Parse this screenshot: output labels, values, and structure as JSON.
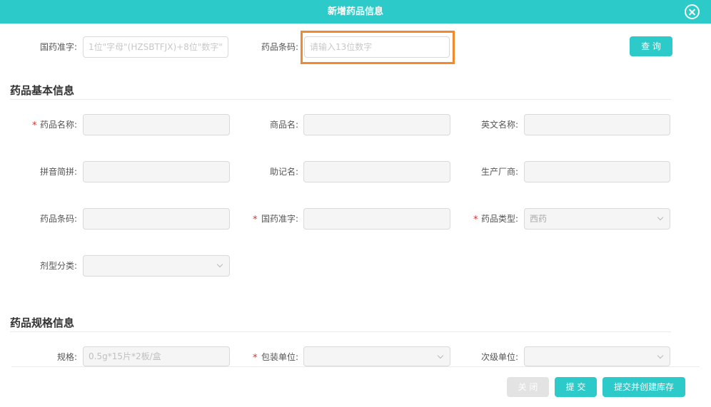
{
  "header": {
    "title": "新增药品信息"
  },
  "search": {
    "approval_label": "国药准字:",
    "approval_placeholder": "1位\"字母\"(HZSBTFJX)+8位\"数字\"",
    "barcode_label": "药品条码:",
    "barcode_placeholder": "请输入13位数字",
    "query_label": "查 询"
  },
  "basic": {
    "section_title": "药品基本信息",
    "required_mark": "*",
    "drug_name_label": "药品名称:",
    "trade_name_label": "商品名:",
    "english_name_label": "英文名称:",
    "pinyin_label": "拼音简拼:",
    "mnemonic_label": "助记名:",
    "manufacturer_label": "生产厂商:",
    "barcode_label": "药品条码:",
    "approval_label": "国药准字:",
    "drug_type_label": "药品类型:",
    "drug_type_value": "西药",
    "dosage_form_label": "剂型分类:"
  },
  "spec": {
    "section_title": "药品规格信息",
    "spec_label": "规格:",
    "spec_placeholder": "0.5g*15片*2板/盒",
    "pack_unit_label": "包装单位:",
    "sub_unit_label": "次级单位:"
  },
  "footer": {
    "close_label": "关 闭",
    "submit_label": "提 交",
    "submit_stock_label": "提交并创建库存"
  },
  "colors": {
    "accent": "#2ccbc9",
    "highlight": "#f6882c",
    "required": "#e02f2f"
  }
}
